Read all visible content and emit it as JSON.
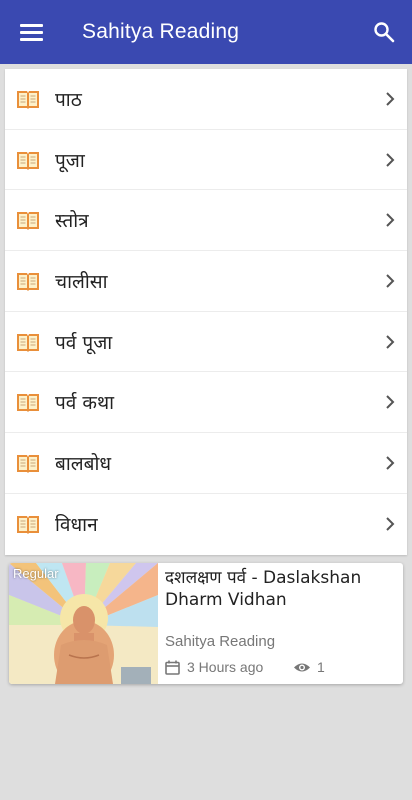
{
  "appbar": {
    "title": "Sahitya Reading"
  },
  "menu": {
    "items": [
      {
        "label": "पाठ"
      },
      {
        "label": "पूजा"
      },
      {
        "label": "स्तोत्र"
      },
      {
        "label": "चालीसा"
      },
      {
        "label": "पर्व पूजा"
      },
      {
        "label": "पर्व कथा"
      },
      {
        "label": "बालबोध"
      },
      {
        "label": "विधान"
      }
    ]
  },
  "post": {
    "badge": "Regular",
    "title": "दशलक्षण पर्व - Daslakshan Dharm Vidhan",
    "author": "Sahitya Reading",
    "time": "3 Hours ago",
    "views": "1"
  },
  "colors": {
    "primary": "#3a49b1",
    "background": "#dedede",
    "book_icon": "#e98f3a"
  },
  "icons": {
    "menu": "hamburger-icon",
    "search": "search-icon",
    "item": "book-icon",
    "arrow": "chevron-right-icon",
    "calendar": "calendar-icon",
    "views": "eye-icon"
  }
}
